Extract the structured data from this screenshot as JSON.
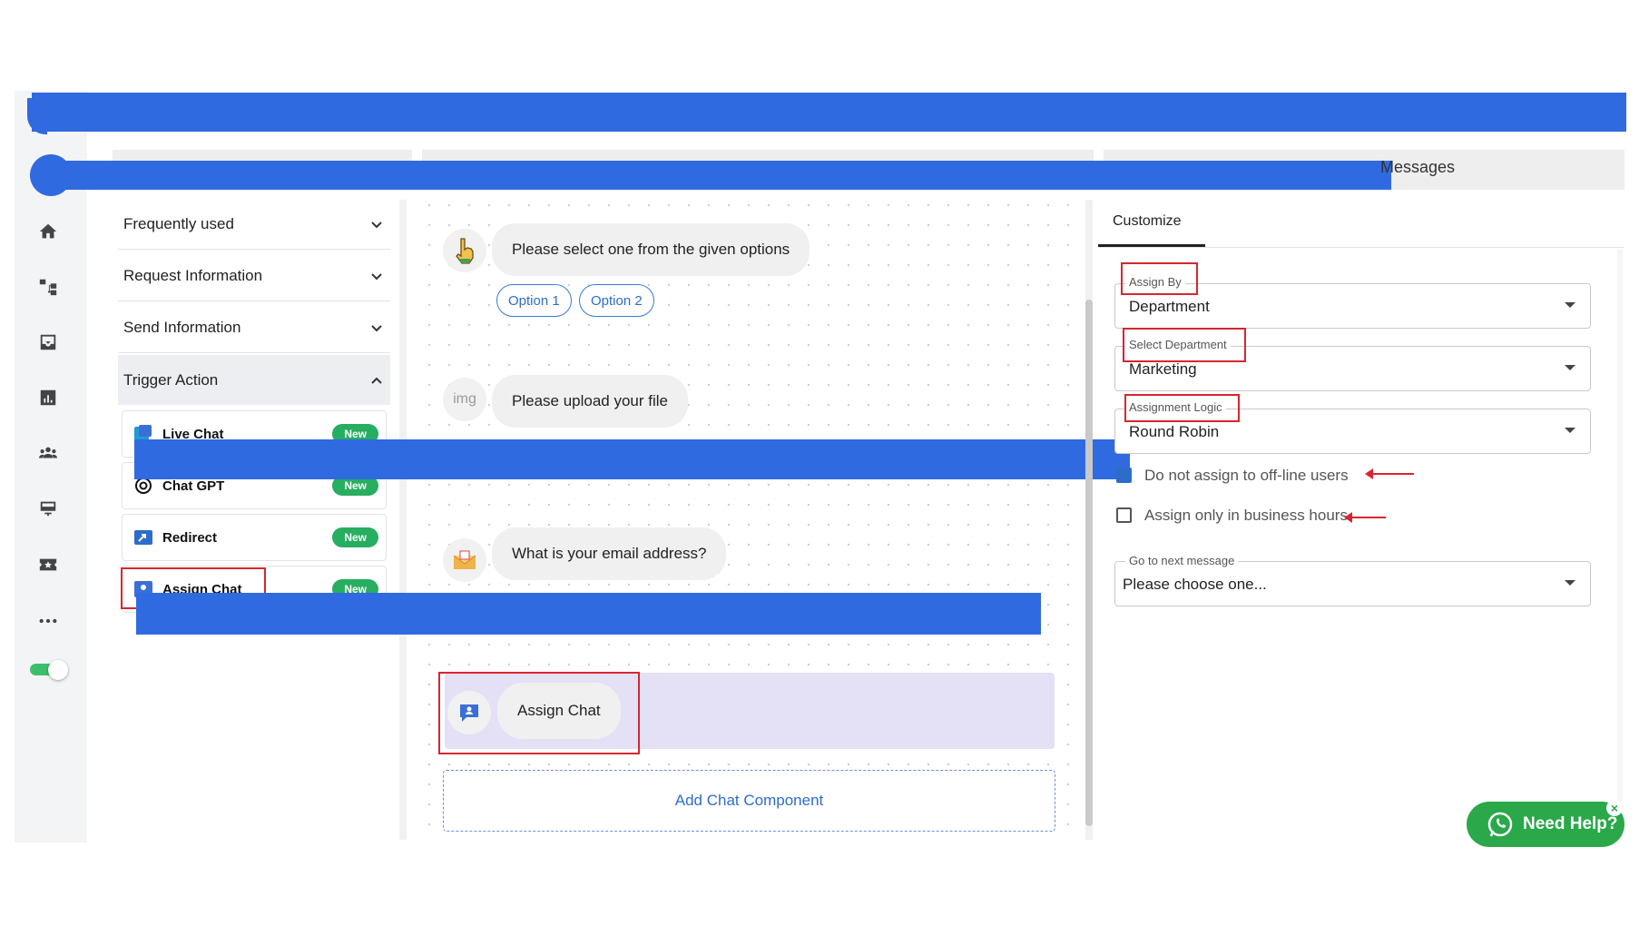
{
  "header": {
    "right_tab_label": "Messages"
  },
  "sidebar": {
    "icons": [
      "home-icon",
      "flow-icon",
      "inbox-icon",
      "analytics-icon",
      "team-icon",
      "display-icon",
      "ticket-icon",
      "more-icon",
      "toggle-switch"
    ],
    "toggle_on": true
  },
  "palette": {
    "sections": [
      {
        "label": "Frequently used",
        "expanded": false
      },
      {
        "label": "Request Information",
        "expanded": false
      },
      {
        "label": "Send Information",
        "expanded": false
      },
      {
        "label": "Trigger Action",
        "expanded": true
      }
    ],
    "items": [
      {
        "label": "Live Chat",
        "badge": "New"
      },
      {
        "label": "Chat GPT",
        "badge": "New"
      },
      {
        "label": "Redirect",
        "badge": "New"
      },
      {
        "label": "Assign Chat",
        "badge": "New"
      }
    ]
  },
  "canvas": {
    "messages": [
      {
        "text": "Please select one from the given options",
        "options": [
          "Option 1",
          "Option 2"
        ]
      },
      {
        "text": "Please upload your file",
        "avatar_alt": "img"
      },
      {
        "text": "What is your email address?"
      }
    ],
    "assign_block": {
      "text": "Assign Chat"
    },
    "add_component": "Add Chat Component"
  },
  "customize": {
    "tab": "Customize",
    "assign_by": {
      "label": "Assign By",
      "value": "Department"
    },
    "department": {
      "label": "Select Department",
      "value": "Marketing"
    },
    "logic": {
      "label": "Assignment Logic",
      "value": "Round Robin"
    },
    "checkbox_offline": {
      "label": "Do not assign to off-line users",
      "checked": true
    },
    "checkbox_hours": {
      "label": "Assign only in business hours",
      "checked": false
    },
    "next": {
      "label": "Go to next message",
      "value": "Please choose one..."
    }
  },
  "help": {
    "label": "Need Help?"
  },
  "colors": {
    "accent": "#2e6ccc",
    "redaction": "#2f6ae0",
    "badge": "#27ae60",
    "annotation": "#d7262e",
    "help": "#2aa84a"
  }
}
